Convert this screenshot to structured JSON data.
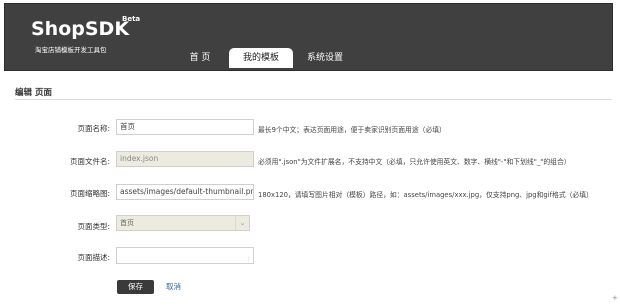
{
  "header": {
    "logo": "ShopSDK",
    "beta": "Beta",
    "tagline": "淘宝店铺模板开发工具包",
    "bg_color": "#404040"
  },
  "nav": {
    "tabs": [
      {
        "label": "首 页",
        "active": false
      },
      {
        "label": "我的模板",
        "active": true
      },
      {
        "label": "系统设置",
        "active": false
      }
    ]
  },
  "section": {
    "title": "编辑 页面"
  },
  "form": {
    "name": {
      "label": "页面名称:",
      "value": "首页",
      "hint": "最长9个中文；表达页面用途，便于卖家识别页面用途（必填）"
    },
    "filename": {
      "label": "页面文件名:",
      "value": "index.json",
      "hint": "必须用\".json\"为文件扩展名，不支持中文（必填，只允许使用英文、数字、横线\"-\"和下划线\"_\"的组合）"
    },
    "thumbnail": {
      "label": "页面缩略图:",
      "value": "assets/images/default-thumbnail.png",
      "hint": "180x120，请填写图片相对（模板）路径，如：assets/images/xxx.jpg，仅支持png、jpg和gif格式（必填）"
    },
    "type": {
      "label": "页面类型:",
      "value": "首页"
    },
    "description": {
      "label": "页面描述:",
      "value": ""
    }
  },
  "actions": {
    "save_label": "保存",
    "cancel_label": "取消"
  },
  "corner_mark": "+"
}
